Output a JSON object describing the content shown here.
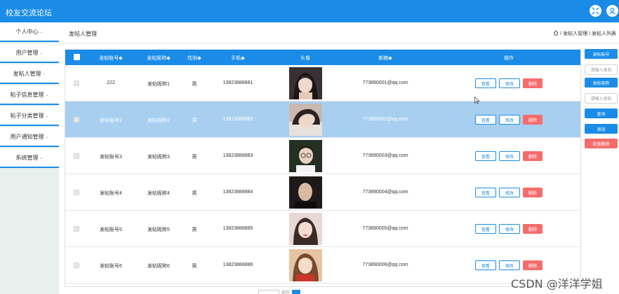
{
  "app": {
    "title": "校友交流论坛"
  },
  "header": {
    "icon_left": "expand-icon",
    "icon_right": "user-icon"
  },
  "sidebar": {
    "items": [
      {
        "label": "个人中心",
        "caret": "⌄"
      },
      {
        "label": "用户管理",
        "caret": "⌄"
      },
      {
        "label": "发帖人管理",
        "caret": "⌄"
      },
      {
        "label": "帖子信息管理",
        "caret": "⌄"
      },
      {
        "label": "帖子分类管理",
        "caret": "⌄"
      },
      {
        "label": "用户通知管理",
        "caret": "⌄"
      },
      {
        "label": "系统管理",
        "caret": "⌄"
      }
    ]
  },
  "breadcrumb": {
    "page_title": "发帖人管理",
    "home_icon": "home-icon",
    "trail": "/ 发帖人管理 / 发帖人列表"
  },
  "table": {
    "headers": [
      "发帖账号◆",
      "发帖昵称◆",
      "性别◆",
      "手机◆",
      "头像",
      "邮箱◆",
      "操作"
    ],
    "action_labels": {
      "view": "查看",
      "edit": "修改",
      "delete": "删除"
    },
    "rows": [
      {
        "account": "222",
        "nickname": "发帖昵称1",
        "gender": "男",
        "phone": "13823888881",
        "email": "773890001@qq.com",
        "avatar": "portrait-1",
        "selected": false
      },
      {
        "account": "发帖账号2",
        "nickname": "发帖昵称2",
        "gender": "男",
        "phone": "13823888882",
        "email": "773890002@qq.com",
        "avatar": "portrait-2",
        "selected": true
      },
      {
        "account": "发帖账号3",
        "nickname": "发帖昵称3",
        "gender": "男",
        "phone": "13823888883",
        "email": "773890003@qq.com",
        "avatar": "portrait-3",
        "selected": false
      },
      {
        "account": "发帖账号4",
        "nickname": "发帖昵称4",
        "gender": "男",
        "phone": "13823888884",
        "email": "773890004@qq.com",
        "avatar": "portrait-4",
        "selected": false
      },
      {
        "account": "发帖账号5",
        "nickname": "发帖昵称5",
        "gender": "男",
        "phone": "13823888885",
        "email": "773890005@qq.com",
        "avatar": "portrait-5",
        "selected": false
      },
      {
        "account": "发帖账号6",
        "nickname": "发帖昵称6",
        "gender": "男",
        "phone": "13823888886",
        "email": "773890006@qq.com",
        "avatar": "portrait-6",
        "selected": false
      }
    ]
  },
  "right_panel": {
    "account_label": "发帖账号",
    "account_placeholder": "请输入发帖",
    "nickname_label": "发帖昵称",
    "nickname_placeholder": "请输入发帖",
    "search_label": "查询",
    "add_label": "添加",
    "batch_delete_label": "批量删除"
  },
  "pager": {
    "label": "前往"
  },
  "watermark": "CSDN @洋洋学姐",
  "colors": {
    "primary": "#1a8ce8",
    "danger": "#f56c6c",
    "selected_row": "#a8cff0",
    "sidebar_bg": "#e8f0ee"
  }
}
